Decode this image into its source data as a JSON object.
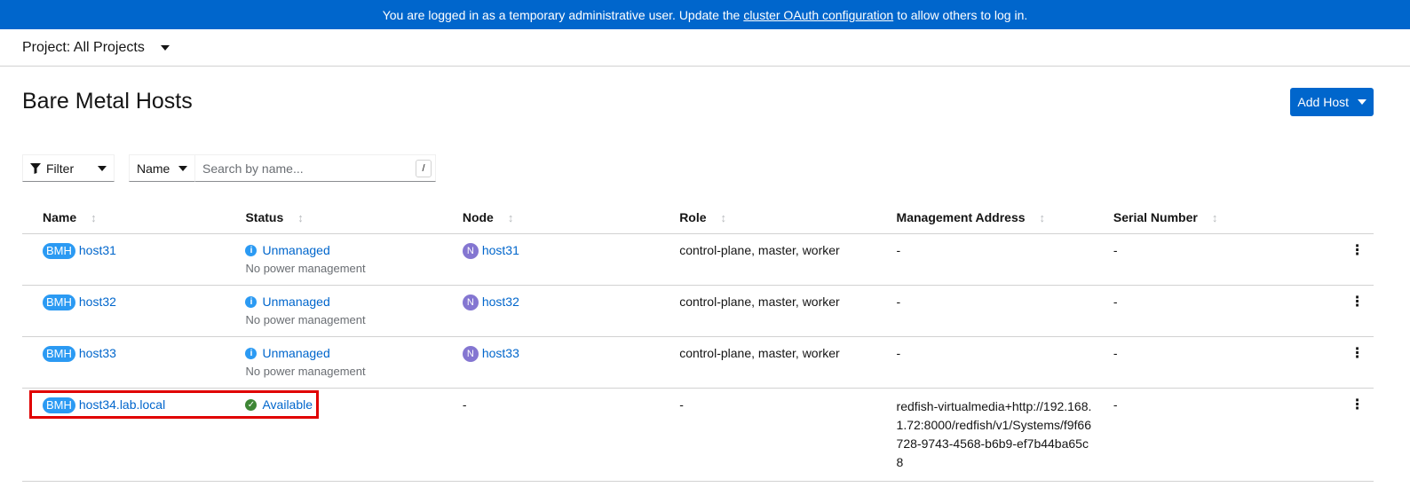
{
  "banner": {
    "text_before": "You are logged in as a temporary administrative user. Update the",
    "link": "cluster OAuth configuration",
    "text_after": "to allow others to log in."
  },
  "project": {
    "label": "Project: All Projects"
  },
  "page": {
    "title": "Bare Metal Hosts",
    "add_button": "Add Host"
  },
  "toolbar": {
    "filter_label": "Filter",
    "name_select": "Name",
    "search_placeholder": "Search by name...",
    "shortcut": "/"
  },
  "table": {
    "columns": [
      "Name",
      "Status",
      "Node",
      "Role",
      "Management Address",
      "Serial Number"
    ],
    "rows": [
      {
        "badge": "BMH",
        "name": "host31",
        "status": "Unmanaged",
        "status_sub": "No power management",
        "node_badge": "N",
        "node": "host31",
        "role": "control-plane, master, worker",
        "mgmt": "-",
        "serial": "-"
      },
      {
        "badge": "BMH",
        "name": "host32",
        "status": "Unmanaged",
        "status_sub": "No power management",
        "node_badge": "N",
        "node": "host32",
        "role": "control-plane, master, worker",
        "mgmt": "-",
        "serial": "-"
      },
      {
        "badge": "BMH",
        "name": "host33",
        "status": "Unmanaged",
        "status_sub": "No power management",
        "node_badge": "N",
        "node": "host33",
        "role": "control-plane, master, worker",
        "mgmt": "-",
        "serial": "-"
      },
      {
        "badge": "BMH",
        "name": "host34.lab.local",
        "status": "Available",
        "node": "-",
        "role": "-",
        "mgmt": "redfish-virtualmedia+http://192.168.1.72:8000/redfish/v1/Systems/f9f66728-9743-4568-b6b9-ef7b44ba65c8",
        "serial": "-"
      }
    ]
  },
  "colors": {
    "accent": "#0066cc",
    "highlight": "#e00000",
    "available": "#3e8635",
    "info": "#2b9af3"
  }
}
